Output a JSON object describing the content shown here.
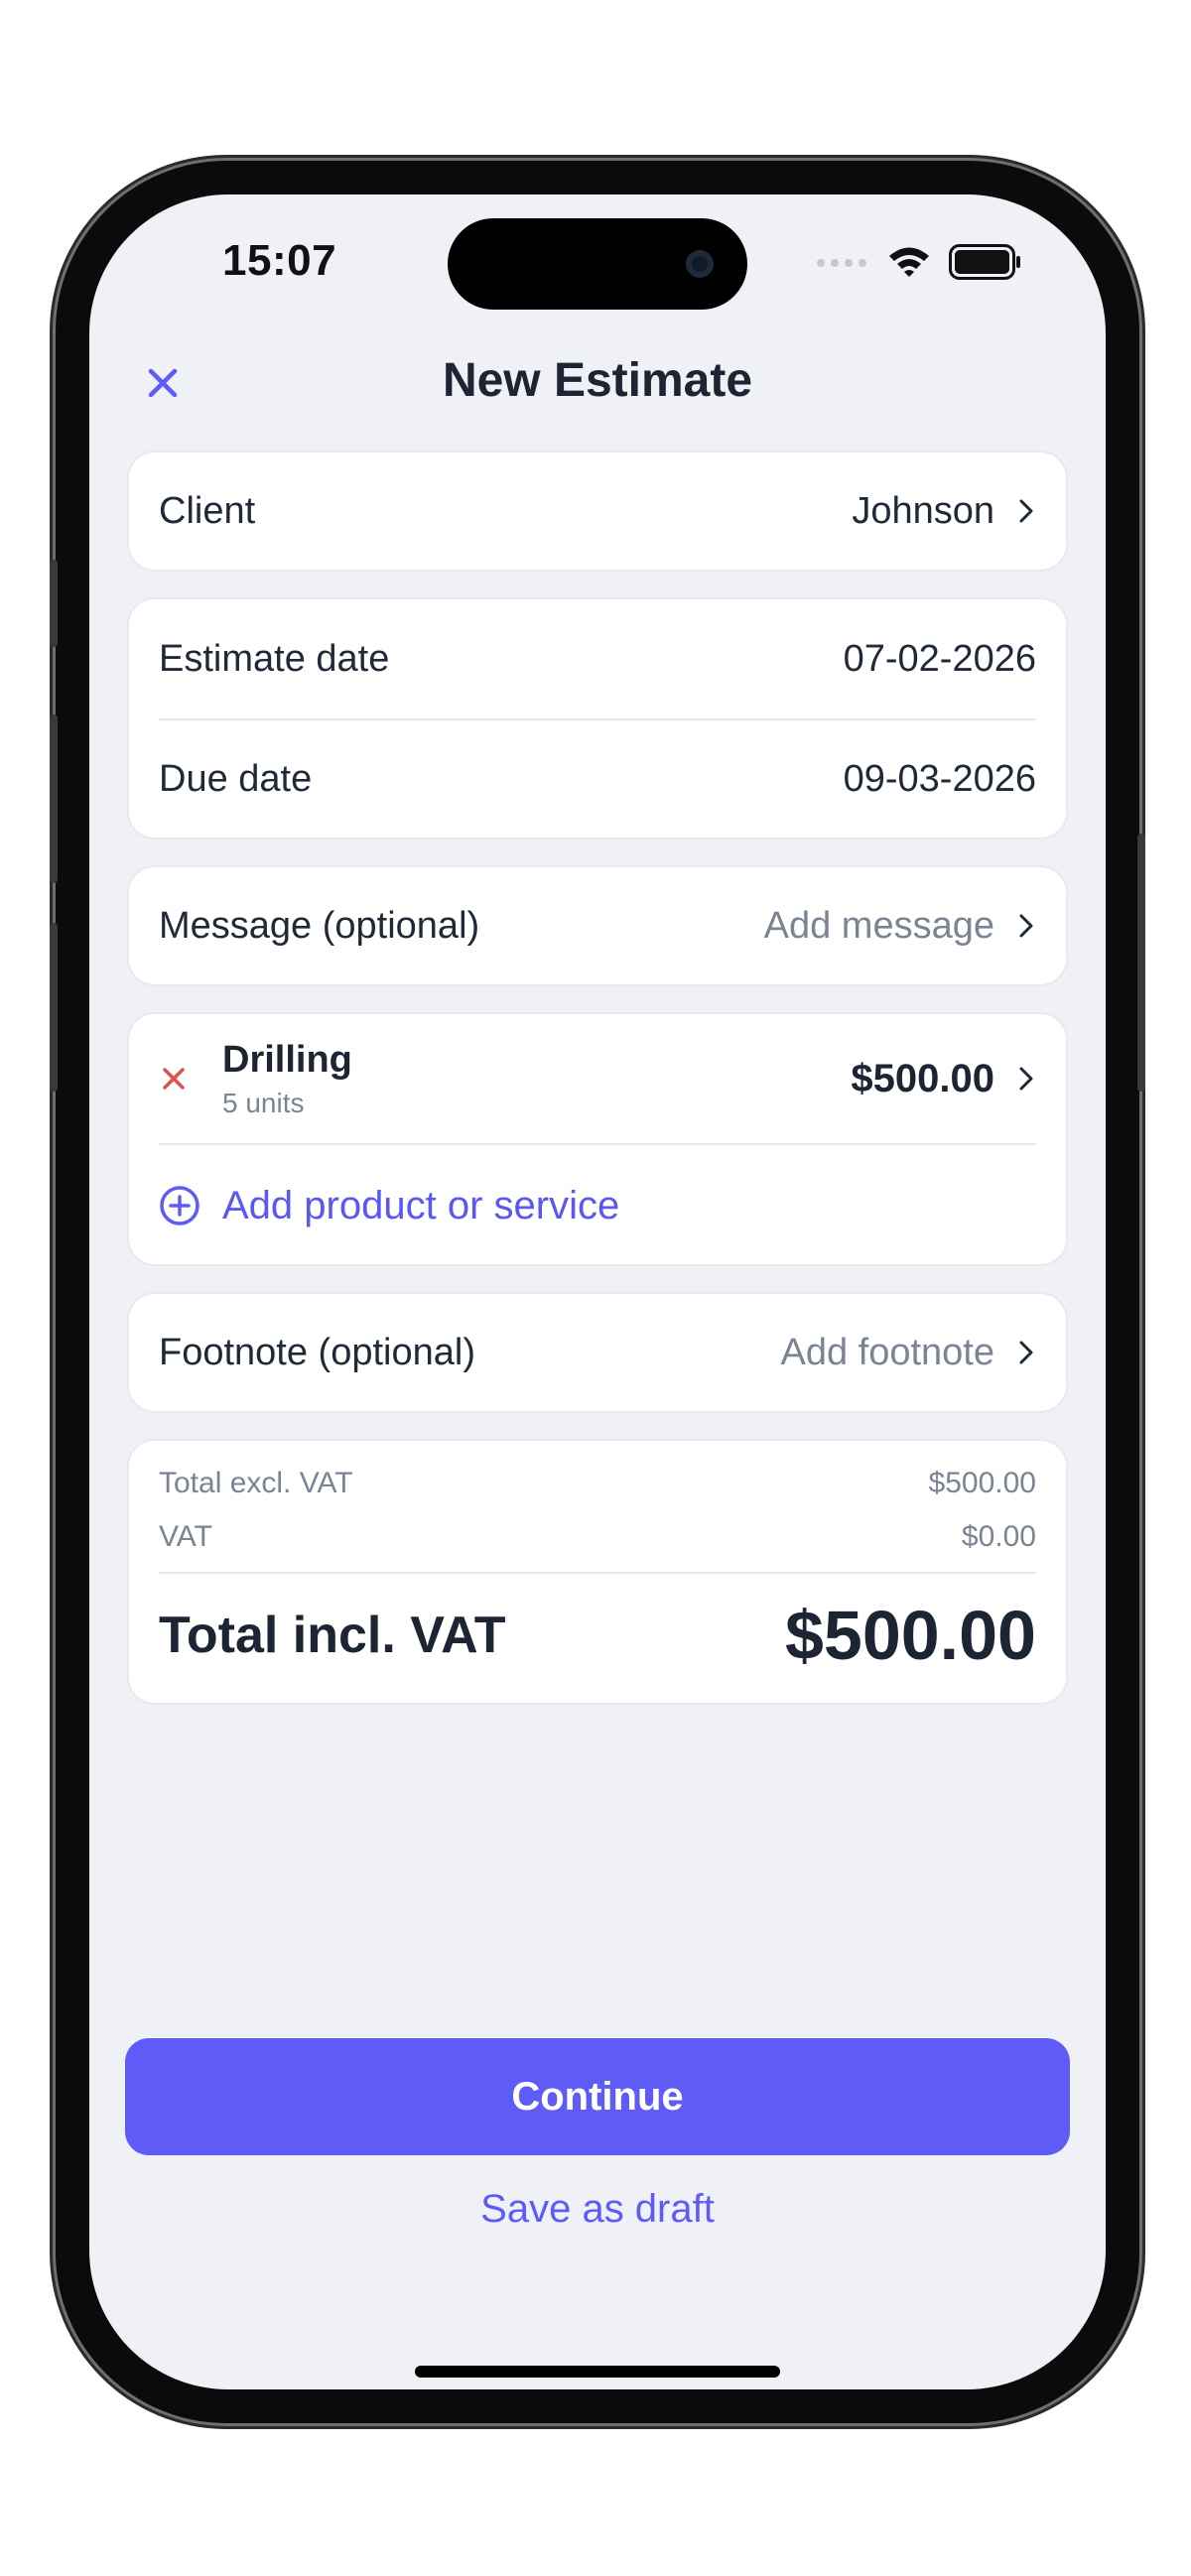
{
  "status_bar": {
    "time": "15:07"
  },
  "nav": {
    "title": "New Estimate",
    "close_icon": "close-icon"
  },
  "client": {
    "label": "Client",
    "value": "Johnson"
  },
  "dates": {
    "estimate_label": "Estimate date",
    "estimate_value": "07-02-2026",
    "due_label": "Due date",
    "due_value": "09-03-2026"
  },
  "message": {
    "label": "Message (optional)",
    "placeholder": "Add message"
  },
  "items": [
    {
      "name": "Drilling",
      "quantity": "5 units",
      "price": "$500.00"
    }
  ],
  "add_product": {
    "label": "Add product or service"
  },
  "footnote": {
    "label": "Footnote (optional)",
    "placeholder": "Add footnote"
  },
  "totals": {
    "excl_label": "Total excl. VAT",
    "excl_value": "$500.00",
    "vat_label": "VAT",
    "vat_value": "$0.00",
    "incl_label": "Total incl. VAT",
    "incl_value": "$500.00"
  },
  "actions": {
    "continue": "Continue",
    "save_draft": "Save as draft"
  },
  "colors": {
    "accent": "#5e5bf6",
    "danger": "#e05252",
    "background": "#eff1f6",
    "text": "#1d2433"
  }
}
